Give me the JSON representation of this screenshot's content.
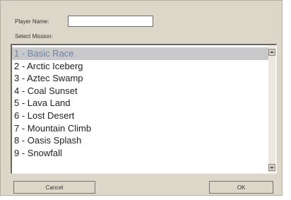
{
  "form": {
    "player_name_label": "Player Name:",
    "player_name_value": "",
    "select_mission_label": "Select Mission:"
  },
  "missions": [
    {
      "label": "1 - Basic Race",
      "selected": true
    },
    {
      "label": "2 - Arctic Iceberg",
      "selected": false
    },
    {
      "label": "3 - Aztec Swamp",
      "selected": false
    },
    {
      "label": "4 - Coal Sunset",
      "selected": false
    },
    {
      "label": "5 - Lava Land",
      "selected": false
    },
    {
      "label": "6 - Lost Desert",
      "selected": false
    },
    {
      "label": "7 - Mountain Climb",
      "selected": false
    },
    {
      "label": "8 - Oasis Splash",
      "selected": false
    },
    {
      "label": "9 - Snowfall",
      "selected": false
    }
  ],
  "buttons": {
    "cancel": "Cancel",
    "ok": "OK"
  },
  "icons": {
    "scroll_up": "triangle-up",
    "scroll_down": "triangle-down"
  },
  "colors": {
    "dialog_bg": "#ddd7ca",
    "selected_row_bg": "#c9c9cc",
    "selected_row_text": "#6a86a9"
  }
}
